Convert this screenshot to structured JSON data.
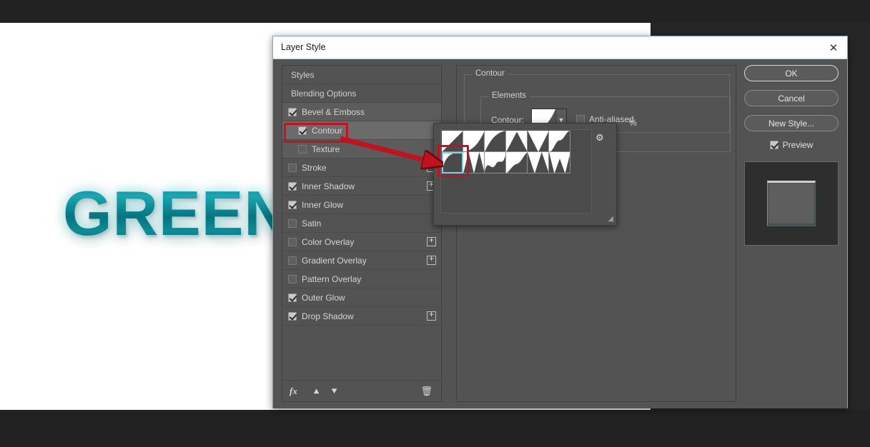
{
  "artwork": {
    "text": "GREEN",
    "color": "#0d8c97",
    "glow_color": "#aaf0f5"
  },
  "dialog": {
    "title": "Layer Style",
    "close_icon": "close-icon"
  },
  "styles_panel": {
    "items": [
      {
        "label": "Styles",
        "checkbox": "none",
        "indent": "none",
        "plus": false,
        "state": "normal"
      },
      {
        "label": "Blending Options",
        "checkbox": "none",
        "indent": "none",
        "plus": false,
        "state": "normal"
      },
      {
        "label": "Bevel & Emboss",
        "checkbox": "on",
        "indent": "none",
        "plus": false,
        "state": "shaded"
      },
      {
        "label": "Contour",
        "checkbox": "on",
        "indent": "sub",
        "plus": false,
        "state": "selected"
      },
      {
        "label": "Texture",
        "checkbox": "off",
        "indent": "sub",
        "plus": false,
        "state": "shaded"
      },
      {
        "label": "Stroke",
        "checkbox": "off",
        "indent": "none",
        "plus": true,
        "state": "normal"
      },
      {
        "label": "Inner Shadow",
        "checkbox": "on",
        "indent": "none",
        "plus": true,
        "state": "normal"
      },
      {
        "label": "Inner Glow",
        "checkbox": "on",
        "indent": "none",
        "plus": false,
        "state": "normal"
      },
      {
        "label": "Satin",
        "checkbox": "off",
        "indent": "none",
        "plus": false,
        "state": "normal"
      },
      {
        "label": "Color Overlay",
        "checkbox": "off",
        "indent": "none",
        "plus": true,
        "state": "normal"
      },
      {
        "label": "Gradient Overlay",
        "checkbox": "off",
        "indent": "none",
        "plus": true,
        "state": "normal"
      },
      {
        "label": "Pattern Overlay",
        "checkbox": "off",
        "indent": "none",
        "plus": false,
        "state": "normal"
      },
      {
        "label": "Outer Glow",
        "checkbox": "on",
        "indent": "none",
        "plus": false,
        "state": "normal"
      },
      {
        "label": "Drop Shadow",
        "checkbox": "on",
        "indent": "none",
        "plus": true,
        "state": "normal"
      }
    ],
    "footer": {
      "fx_label": "fx",
      "move_up_icon": "arrow-up-icon",
      "move_down_icon": "arrow-down-icon",
      "delete_icon": "trash-icon"
    }
  },
  "settings": {
    "group_title": "Contour",
    "elements_title": "Elements",
    "contour_label": "Contour:",
    "antialiased_label": "Anti-aliased",
    "antialiased_checked": "off",
    "range_unit": "%",
    "dropdown_icon": "chevron-down-icon"
  },
  "buttons": {
    "ok": "OK",
    "cancel": "Cancel",
    "new_style": "New Style...",
    "preview_label": "Preview",
    "preview_checked": "on"
  },
  "contour_picker": {
    "gear_icon": "gear-icon",
    "resize_icon": "resize-grip-icon",
    "selected_index": 6,
    "shapes": [
      "linear",
      "cone",
      "cone-inverted",
      "double-ring",
      "ring",
      "gaussian",
      "half-round",
      "ring-double",
      "rolling-slope",
      "rounded-steps",
      "sawtooth-1",
      "sawtooth-2"
    ]
  },
  "annotations": {
    "contour_row_highlight": "red-rectangle",
    "picker_cell_highlight": "red-rectangle",
    "arrow": "red-arrow"
  }
}
